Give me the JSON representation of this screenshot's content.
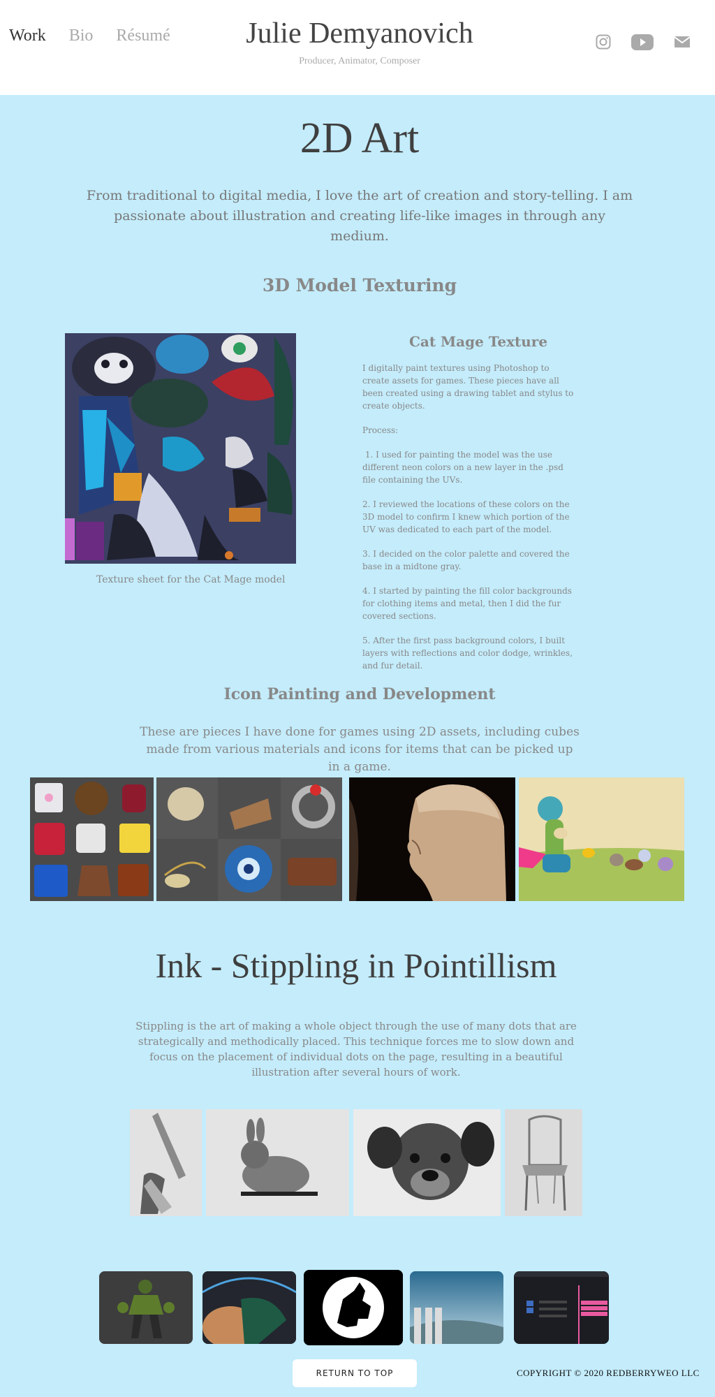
{
  "nav": {
    "items": [
      {
        "label": "Work"
      },
      {
        "label": "Bio"
      },
      {
        "label": "Résumé"
      }
    ]
  },
  "site": {
    "title": "Julie Demyanovich",
    "subtitle": "Producer, Animator, Composer"
  },
  "social": {
    "icons": [
      "instagram-icon",
      "youtube-icon",
      "mail-icon"
    ]
  },
  "page": {
    "title": "2D Art",
    "intro": "From traditional to digital media, I love the art of creation and story-telling. I am passionate about illustration and creating life-like images in through any medium."
  },
  "texturing": {
    "heading": "3D Model Texturing",
    "image_caption": "Texture sheet for the Cat Mage model",
    "title": "Cat Mage Texture",
    "paragraphs": [
      "I digitally paint textures using Photoshop to create assets for games. These pieces have all been created using a drawing tablet and stylus to create objects.",
      "Process:",
      " 1. I used for painting the model was the use different neon colors on a new layer in the .psd file containing the UVs.",
      "2. I reviewed the locations of these colors on the 3D model to confirm I knew which portion of the UV was dedicated to each part of the model.",
      "3. I decided on the color palette and covered the base in a midtone gray.",
      "4. I started by painting the fill color backgrounds for clothing items and metal, then I did the fur covered sections.",
      "5. After the first pass background colors, I built layers with reflections and color dodge, wrinkles, and fur detail."
    ]
  },
  "icons_section": {
    "heading": "Icon Painting and Development",
    "description": "These are pieces I have done for games using 2D assets, including cubes made from various materials and icons for items that can be picked up in a game."
  },
  "ink": {
    "heading": "Ink - Stippling in Pointillism",
    "description": "Stippling is the art of making a whole object through the use of many dots that are strategically and methodically placed. This technique forces me to slow down and focus on the placement of individual dots on the page, resulting in a beautiful illustration after several hours of work."
  },
  "footer": {
    "return_label": "RETURN TO TOP",
    "copyright": "COPYRIGHT © 2020 REDBERRYWEO LLC"
  },
  "colors": {
    "background": "#c4ecfb",
    "header": "#ffffff",
    "heading": "#3f3f3f",
    "body_text": "#888888"
  }
}
